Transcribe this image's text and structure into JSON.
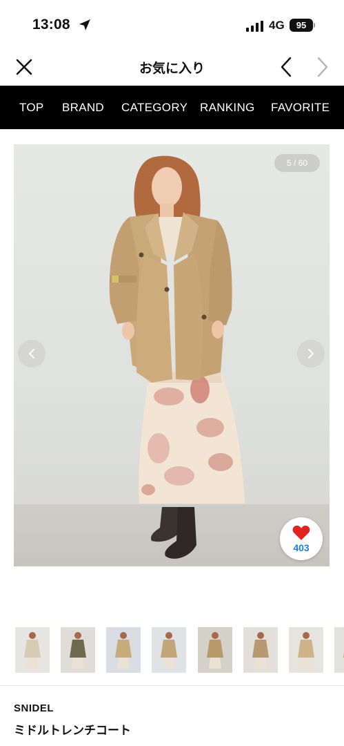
{
  "status_bar": {
    "time": "13:08",
    "network": "4G",
    "battery": "95"
  },
  "header": {
    "title": "お気に入り"
  },
  "menu": [
    {
      "label": "TOP"
    },
    {
      "label": "BRAND"
    },
    {
      "label": "CATEGORY"
    },
    {
      "label": "RANKING"
    },
    {
      "label": "FAVORITE"
    }
  ],
  "gallery": {
    "counter": "5 / 60",
    "likes": "403",
    "like_color": "#e32222"
  },
  "thumbnails": [
    {
      "bg": "#e7e5e1",
      "coat": "#d8cbb4"
    },
    {
      "bg": "#e0ddd8",
      "coat": "#6b6a4d"
    },
    {
      "bg": "#d9dde3",
      "coat": "#c6ab7c"
    },
    {
      "bg": "#dfe3e6",
      "coat": "#c2a579"
    },
    {
      "bg": "#d4d1c9",
      "coat": "#b99a6d"
    },
    {
      "bg": "#e3e0db",
      "coat": "#b89a72"
    },
    {
      "bg": "#e6e4df",
      "coat": "#cdb28a"
    },
    {
      "bg": "#e3e1dc",
      "coat": "#b69c75"
    }
  ],
  "product": {
    "brand": "SNIDEL",
    "name": "ミドルトレンチコート"
  },
  "colors": {
    "menu_bg": "#000000",
    "coat": "#c9a879",
    "skirt": "#f3e6d6",
    "like_count": "#1f7fd6"
  }
}
